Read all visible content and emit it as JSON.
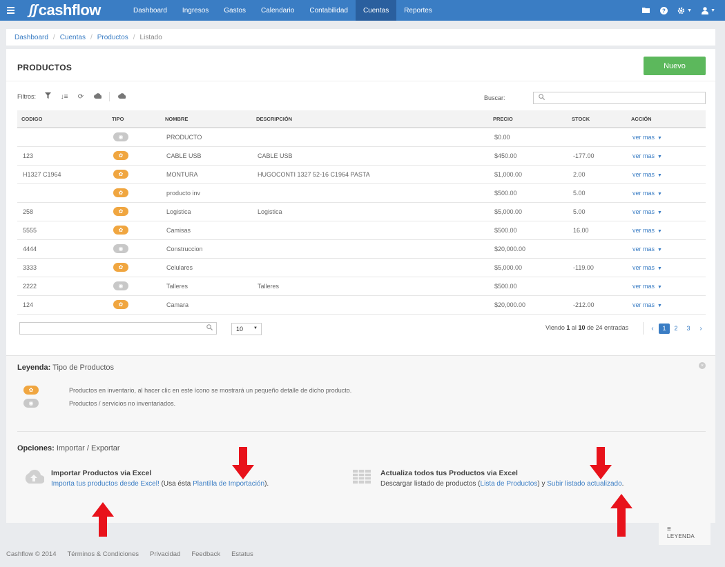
{
  "app": {
    "logo": "cashflow"
  },
  "nav": {
    "items": [
      "Dashboard",
      "Ingresos",
      "Gastos",
      "Calendario",
      "Contabilidad",
      "Cuentas",
      "Reportes"
    ],
    "active": "Cuentas"
  },
  "breadcrumb": {
    "items": [
      "Dashboard",
      "Cuentas",
      "Productos"
    ],
    "current": "Listado"
  },
  "page": {
    "title": "PRODUCTOS",
    "new_button": "Nuevo"
  },
  "filters": {
    "label": "Filtros:",
    "search_label": "Buscar:",
    "search_value": ""
  },
  "table": {
    "headers": [
      "CODIGO",
      "TIPO",
      "NOMBRE",
      "DESCRIPCIÓN",
      "PRECIO",
      "STOCK",
      "ACCIÓN"
    ],
    "rows": [
      {
        "codigo": "",
        "tipo": "non",
        "nombre": "PRODUCTO",
        "descripcion": "",
        "precio": "$0.00",
        "stock": "",
        "accion": "ver mas"
      },
      {
        "codigo": "123",
        "tipo": "inv",
        "nombre": "CABLE USB",
        "descripcion": "CABLE USB",
        "precio": "$450.00",
        "stock": "-177.00",
        "accion": "ver mas"
      },
      {
        "codigo": "H1327 C1964",
        "tipo": "inv",
        "nombre": "MONTURA",
        "descripcion": "HUGOCONTI 1327 52-16 C1964 PASTA",
        "precio": "$1,000.00",
        "stock": "2.00",
        "accion": "ver mas"
      },
      {
        "codigo": "",
        "tipo": "inv",
        "nombre": "producto inv",
        "descripcion": "",
        "precio": "$500.00",
        "stock": "5.00",
        "accion": "ver mas"
      },
      {
        "codigo": "258",
        "tipo": "inv",
        "nombre": "Logistica",
        "descripcion": "Logistica",
        "precio": "$5,000.00",
        "stock": "5.00",
        "accion": "ver mas"
      },
      {
        "codigo": "5555",
        "tipo": "inv",
        "nombre": "Camisas",
        "descripcion": "",
        "precio": "$500.00",
        "stock": "16.00",
        "accion": "ver mas"
      },
      {
        "codigo": "4444",
        "tipo": "non",
        "nombre": "Construccion",
        "descripcion": "",
        "precio": "$20,000.00",
        "stock": "",
        "accion": "ver mas"
      },
      {
        "codigo": "3333",
        "tipo": "inv",
        "nombre": "Celulares",
        "descripcion": "",
        "precio": "$5,000.00",
        "stock": "-119.00",
        "accion": "ver mas"
      },
      {
        "codigo": "2222",
        "tipo": "non",
        "nombre": "Talleres",
        "descripcion": "Talleres",
        "precio": "$500.00",
        "stock": "",
        "accion": "ver mas"
      },
      {
        "codigo": "124",
        "tipo": "inv",
        "nombre": "Camara",
        "descripcion": "",
        "precio": "$20,000.00",
        "stock": "-212.00",
        "accion": "ver mas"
      }
    ]
  },
  "pagination": {
    "page_size": "10",
    "info_prefix": "Viendo",
    "from": "1",
    "info_al": "al",
    "to": "10",
    "info_de": "de",
    "total": "24",
    "info_suffix": "entradas",
    "pages": [
      "1",
      "2",
      "3"
    ],
    "current": "1"
  },
  "legend": {
    "title_bold": "Leyenda:",
    "title_rest": " Tipo de Productos",
    "inv_text": "Productos en inventario, al hacer clic en este ícono se mostrará un pequeño detalle de dicho producto.",
    "non_text": "Productos / servicios no inventariados."
  },
  "options": {
    "title_bold": "Opciones:",
    "title_rest": " Importar / Exportar",
    "import": {
      "title": "Importar Productos via Excel",
      "link1": "Importa tus productos desde Excel!",
      "mid": " (Usa ésta ",
      "link2": "Plantilla de Importación",
      "end": ")."
    },
    "update": {
      "title": "Actualiza todos tus Productos via Excel",
      "pre": "Descargar listado de productos (",
      "link1": "Lista de Productos",
      "mid": ") y ",
      "link2": "Subir listado actualizado",
      "end": "."
    }
  },
  "legend_tab": "LEYENDA",
  "footer": [
    "Cashflow © 2014",
    "Términos & Condiciones",
    "Privacidad",
    "Feedback",
    "Estatus"
  ],
  "colors": {
    "primary": "#3a7dc4",
    "success": "#5cb85c",
    "inventory": "#f0a640",
    "non_inventory": "#c8c8c8",
    "annotation_arrow": "#e8121b"
  }
}
